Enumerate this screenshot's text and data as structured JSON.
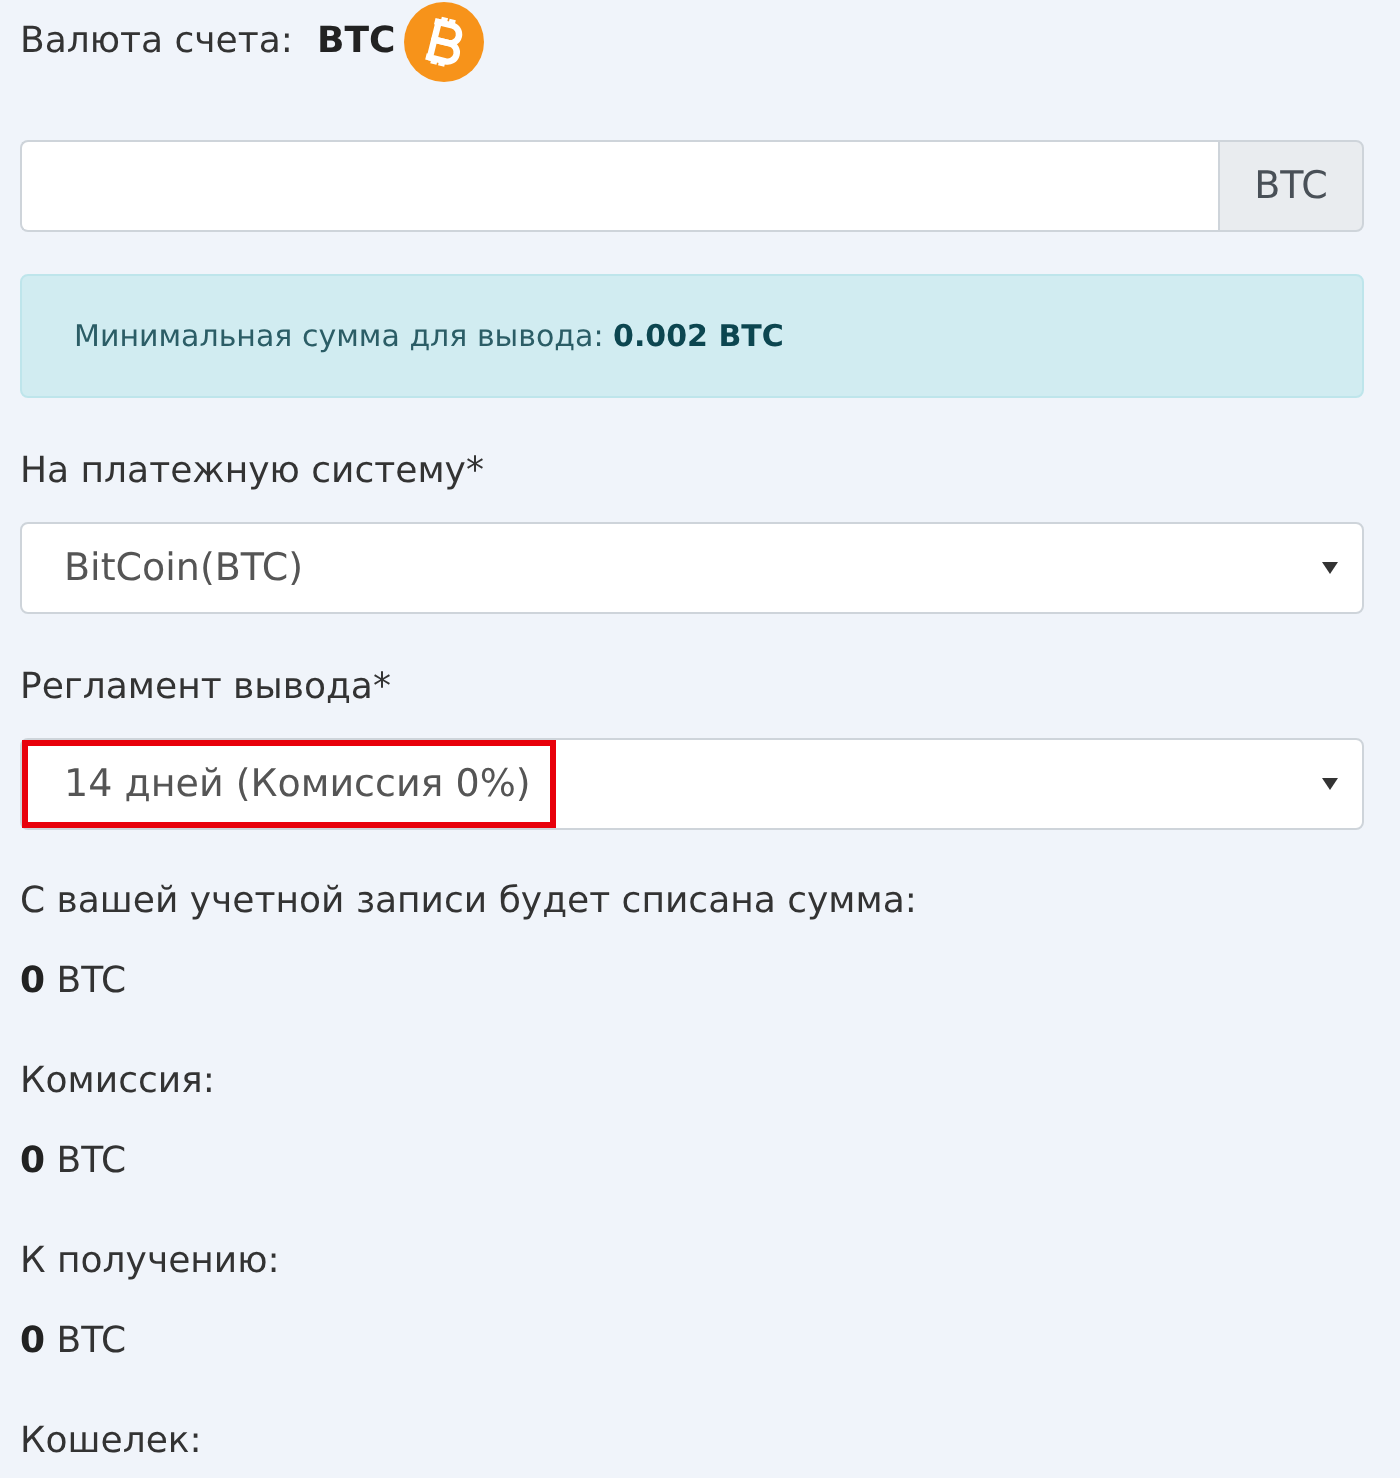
{
  "currency": {
    "label": "Валюта счета:",
    "value": "BTC"
  },
  "amount_field": {
    "addon": "BTC"
  },
  "alert": {
    "text": "Минимальная сумма для вывода: **0.002 BTC**"
  },
  "fields": [
    {
      "label": "На платежную систему*",
      "value": "BitCoin(BTC)",
      "highlighted": false
    },
    {
      "label": "Регламент вывода*",
      "value": "14 дней (Комиссия 0%)",
      "highlighted": true
    }
  ],
  "summary": [
    {
      "label": "С вашей учетной записи будет списана сумма:",
      "value": "**0** BTC"
    },
    {
      "label": "Комиссия:",
      "value": "**0** BTC"
    },
    {
      "label": "К получению:",
      "value": "**0** BTC"
    }
  ],
  "wallet": {
    "label": "Кошелек:"
  }
}
